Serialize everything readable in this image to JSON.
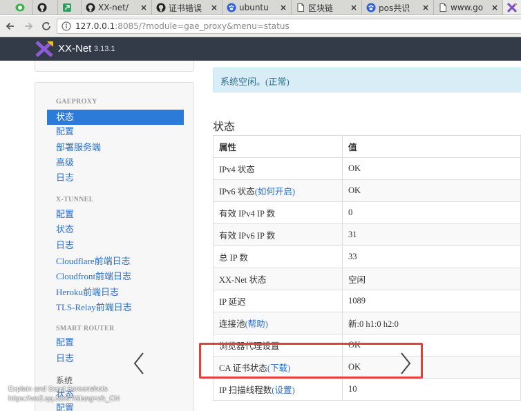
{
  "browser": {
    "tabs": [
      {
        "title": "",
        "icon": "whatsapp-icon"
      },
      {
        "title": "",
        "icon": "github-icon"
      },
      {
        "title": "",
        "icon": "leaf-icon"
      },
      {
        "title": "XX-net/",
        "icon": "github-icon"
      },
      {
        "title": "证书错误",
        "icon": "github-icon"
      },
      {
        "title": "ubuntu",
        "icon": "paw-icon"
      },
      {
        "title": "区块链",
        "icon": "document-icon"
      },
      {
        "title": "pos共识",
        "icon": "paw-icon"
      },
      {
        "title": "www.go",
        "icon": "document-icon"
      },
      {
        "title": "",
        "icon": "xx-net-icon"
      }
    ],
    "close_glyph": "×",
    "url_host": "127.0.0.1",
    "url_rest": ":8085/?module=gae_proxy&menu=status"
  },
  "app": {
    "name": "XX-Net",
    "version": "3.13.1",
    "accent": "#2d7bd8",
    "header_bg": "#333b49"
  },
  "sidebar": {
    "gae_header": "GAEPROXY",
    "gae_items": [
      "状态",
      "配置",
      "部署服务端",
      "高级",
      "日志"
    ],
    "xtunnel_header": "X-TUNNEL",
    "xtunnel_items": [
      "配置",
      "状态",
      "日志",
      "Cloudflare前端日志",
      "Cloudfront前端日志",
      "Heroku前端日志",
      "TLS-Relay前端日志"
    ],
    "router_header": "SMART ROUTER",
    "router_items": [
      "配置",
      "日志"
    ],
    "system_header": "系统",
    "system_items": [
      "状态",
      "配置"
    ]
  },
  "main": {
    "alert": "系统空闲。(正常)",
    "section_title": "状态",
    "table": {
      "headers": [
        "属性",
        "值"
      ],
      "rows": [
        {
          "name": "IPv4 状态",
          "link": "",
          "value": "OK"
        },
        {
          "name": "IPv6 状态",
          "link": "(如何开启)",
          "value": "OK"
        },
        {
          "name": "有效 IPv4 IP 数",
          "link": "",
          "value": "0"
        },
        {
          "name": "有效 IPv6 IP 数",
          "link": "",
          "value": "31"
        },
        {
          "name": "总 IP 数",
          "link": "",
          "value": "33"
        },
        {
          "name": "XX-Net 状态",
          "link": "",
          "value": "空闲"
        },
        {
          "name": "IP 延迟",
          "link": "",
          "value": "1089"
        },
        {
          "name": "连接池",
          "link": "(帮助)",
          "value": "新:0 h1:0 h2:0"
        },
        {
          "name": "浏览器代理设置",
          "link": "",
          "value": "OK"
        },
        {
          "name": "CA 证书状态",
          "link": "(下载)",
          "value": "OK"
        },
        {
          "name": "IP 扫描线程数",
          "link": "(设置)",
          "value": "10"
        }
      ]
    }
  },
  "overlay": {
    "highlight_color": "#e0413a",
    "watermark_line1": "Explain and Send Screenshots",
    "watermark_line2": "https://wx2.qq.com/?&lang=zh_CN"
  }
}
